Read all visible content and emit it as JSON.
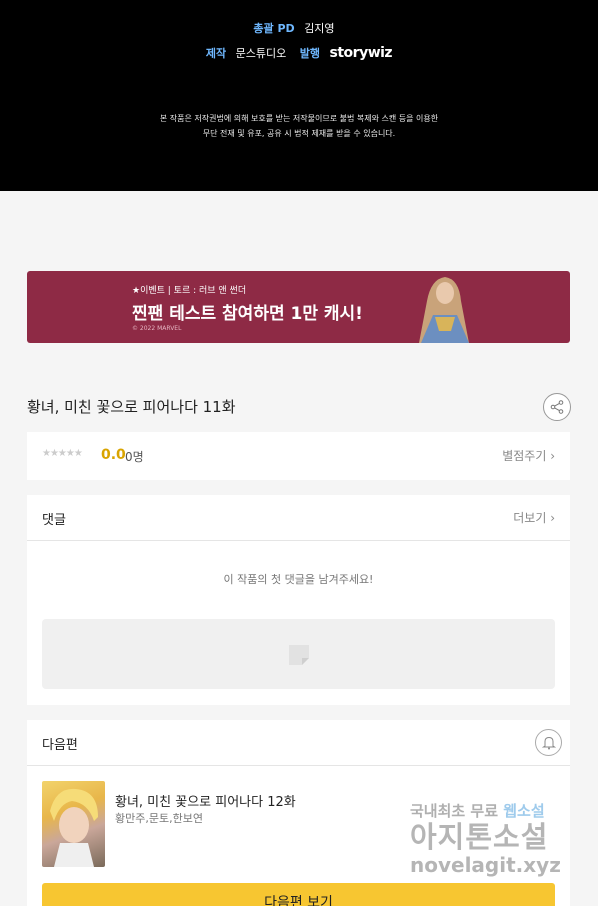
{
  "credits": {
    "top_partial": "••• •• ••••• ••• •••",
    "pd_role": "총괄 PD",
    "pd_name": "김지영",
    "studio_role": "제작",
    "studio_name": "문스튜디오",
    "publisher_role": "발행",
    "publisher_name": "storywiz",
    "notice_line1": "본 작품은 저작권법에 의해 보호를 받는 저작물이므로 불법 복제와 스캔 등을 이용한",
    "notice_line2": "무단 전재 및 유포, 공유 시 법적 제재를 받을 수 있습니다."
  },
  "banner": {
    "tag": "★이벤트 | 토르 : 러브 앤 썬더",
    "headline": "찐팬 테스트 참여하면 1만 캐시!",
    "copyright": "© 2022 MARVEL"
  },
  "episode": {
    "title": "황녀, 미친 꽃으로 피어나다 11화"
  },
  "rating": {
    "stars": "★★★★★",
    "score": "0.0",
    "count": "0명",
    "rate_link": "별점주기 ›"
  },
  "comments": {
    "label": "댓글",
    "more": "더보기 ›",
    "empty": "이 작품의 첫 댓글을 남겨주세요!"
  },
  "next": {
    "label": "다음편",
    "title": "황녀, 미친 꽃으로 피어나다 12화",
    "authors": "황만주,문토,한보연",
    "button": "다음편 보기"
  },
  "watermark": {
    "line1_a": "국내최초 무료 ",
    "line1_b": "웹소설",
    "line2": "아지톤소설",
    "line3": "novelagit.xyz"
  },
  "colors": {
    "accent_blue": "#6fb8ff",
    "banner_bg": "#8e2a45",
    "score_gold": "#d9a400",
    "next_button": "#f7c631"
  }
}
